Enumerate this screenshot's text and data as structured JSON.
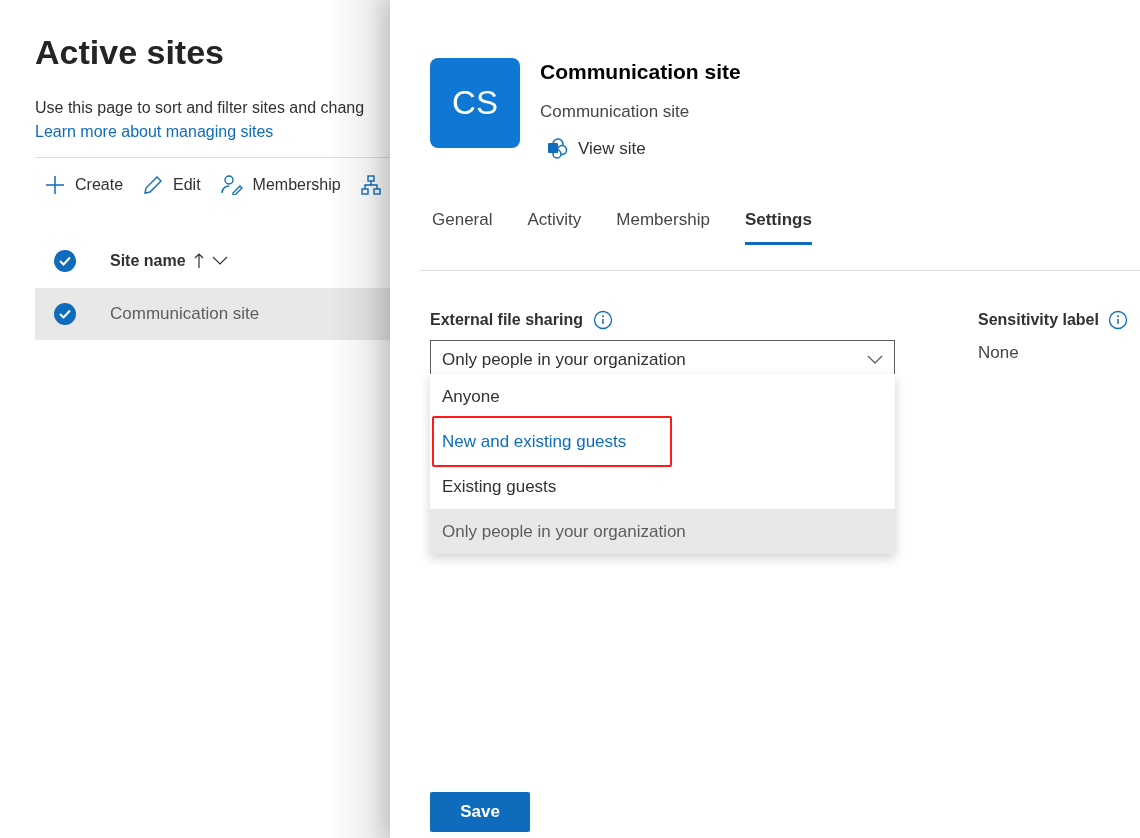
{
  "page": {
    "title": "Active sites",
    "description": "Use this page to sort and filter sites and chang",
    "link": "Learn more about managing sites",
    "toolbar": [
      {
        "kind": "plus",
        "label": "Create"
      },
      {
        "kind": "pencil",
        "label": "Edit"
      },
      {
        "kind": "person",
        "label": "Membership"
      },
      {
        "kind": "hierarchy"
      }
    ],
    "table": {
      "columns": [
        {
          "label": "Site name",
          "sorted": true
        }
      ],
      "header_checked": true,
      "rows": [
        {
          "checked": true,
          "selected": true,
          "cells": [
            "Communication site"
          ]
        }
      ]
    }
  },
  "panel": {
    "avatar": "CS",
    "title": "Communication site",
    "subtitle": "Communication site",
    "view_link": "View site",
    "tabs": [
      {
        "label": "General",
        "selected": false
      },
      {
        "label": "Activity",
        "selected": false
      },
      {
        "label": "Membership",
        "selected": false
      },
      {
        "label": "Settings",
        "selected": true
      }
    ],
    "sharing": {
      "label": "External file sharing",
      "value": "Only people in your organization",
      "expanded": true,
      "options": [
        {
          "label": "Anyone",
          "selected": false,
          "hovered": false,
          "annotated": false
        },
        {
          "label": "New and existing guests",
          "selected": false,
          "hovered": true,
          "annotated": true
        },
        {
          "label": "Existing guests",
          "selected": false,
          "hovered": false,
          "annotated": false
        },
        {
          "label": "Only people in your organization",
          "selected": true,
          "hovered": false,
          "annotated": false
        }
      ]
    },
    "sensitivity": {
      "label": "Sensitivity label",
      "value": "None"
    },
    "save": "Save"
  }
}
